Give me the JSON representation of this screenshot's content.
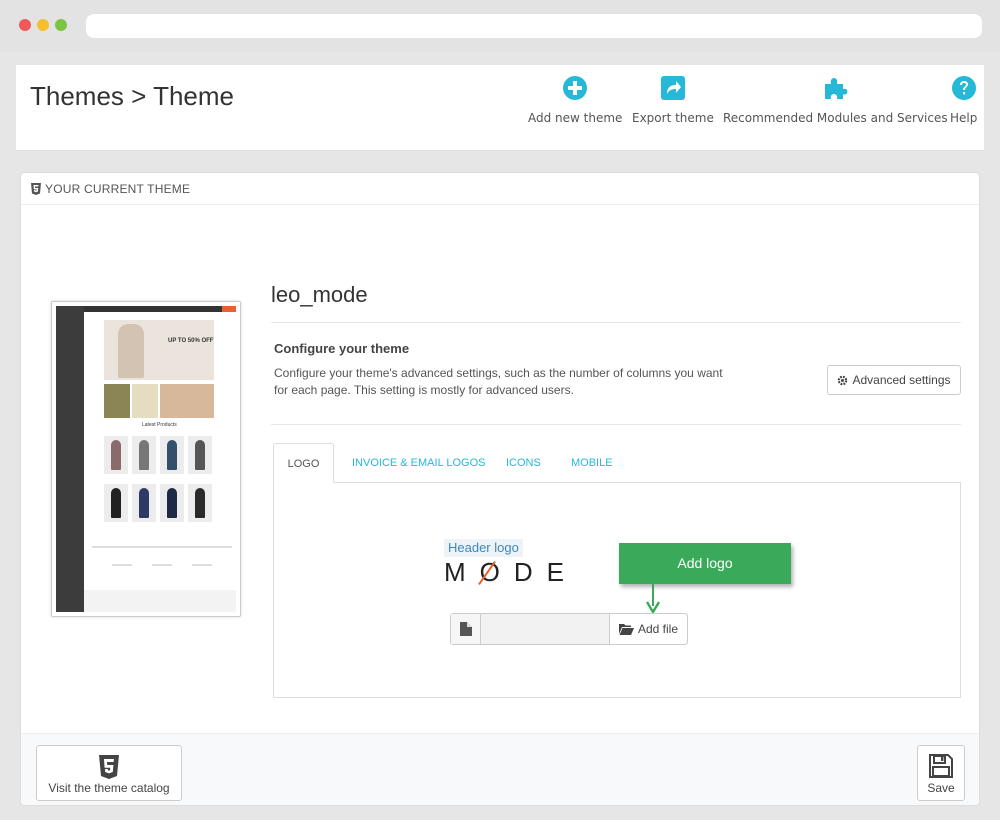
{
  "header": {
    "title": "Themes > Theme",
    "toolbar": [
      {
        "label": "Add new theme",
        "icon": "plus-circle-icon"
      },
      {
        "label": "Export theme",
        "icon": "export-share-icon"
      },
      {
        "label": "Recommended Modules and Services",
        "icon": "puzzle-icon"
      },
      {
        "label": "Help",
        "icon": "question-circle-icon"
      }
    ]
  },
  "panel": {
    "heading": "YOUR CURRENT THEME",
    "theme_name": "leo_mode",
    "preview": {
      "hero_text": "UP TO 50% OFF",
      "section_title": "Latest Products"
    },
    "configure": {
      "title": "Configure your theme",
      "description": "Configure your theme's advanced settings, such as the number of columns you want for each page. This setting is mostly for advanced users.",
      "advanced_button": "Advanced settings"
    },
    "tabs": [
      {
        "label": "LOGO",
        "active": true
      },
      {
        "label": "INVOICE & EMAIL LOGOS",
        "active": false
      },
      {
        "label": "ICONS",
        "active": false
      },
      {
        "label": "MOBILE",
        "active": false
      }
    ],
    "logo_tab": {
      "header_logo_label": "Header logo",
      "logo_text": "MODE",
      "add_file_button": "Add file",
      "callout_text": "Add logo"
    },
    "footer": {
      "catalog_button": "Visit the theme catalog",
      "save_button": "Save"
    }
  },
  "colors": {
    "accent": "#25b9d7",
    "callout": "#3aaa5a",
    "brand_orange": "#e8602c"
  }
}
